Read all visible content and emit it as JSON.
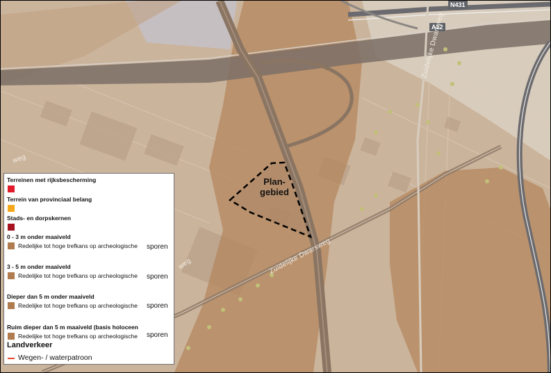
{
  "map": {
    "road_labels": {
      "a12": "A12",
      "n431": "N431"
    },
    "street_labels": {
      "dwarsweg_main": "Zuidelijke Dwarsweg",
      "dwarsweg_top": "Zuidelijke Dwarsweg",
      "weg_left": "weg",
      "weg_mid": "weg"
    },
    "plan_area_label": "Plan-\ngebied",
    "colors": {
      "base": "#cbb49c",
      "archaeology_zone": "#b4875e",
      "roads_main": "#7b6e66",
      "legend_red": "#e21b2a",
      "legend_orange": "#f5a81c",
      "legend_darkred": "#a6121f",
      "legend_brown": "#b07b4f",
      "road_pattern": "#e8462a"
    }
  },
  "legend": {
    "rijksbescherming": "Terreinen met rijksbescherming",
    "provinciaal": "Terrein van provinciaal belang",
    "stads": "Stads- en dorpskernen",
    "depth_0_3": "0 - 3 m onder maaiveld",
    "depth_3_5": "3 - 5 m onder maaiveld",
    "depth_5": "Dieper dan 5 m onder maaiveld",
    "depth_ruim": "Ruim dieper dan 5 m maaiveld (basis holoceen",
    "trefkans": "Redelijke tot hoge trefkans op archeologische",
    "sporen": "sporen",
    "section": "Landverkeer",
    "road_pattern": "Wegen- / waterpatroon"
  }
}
